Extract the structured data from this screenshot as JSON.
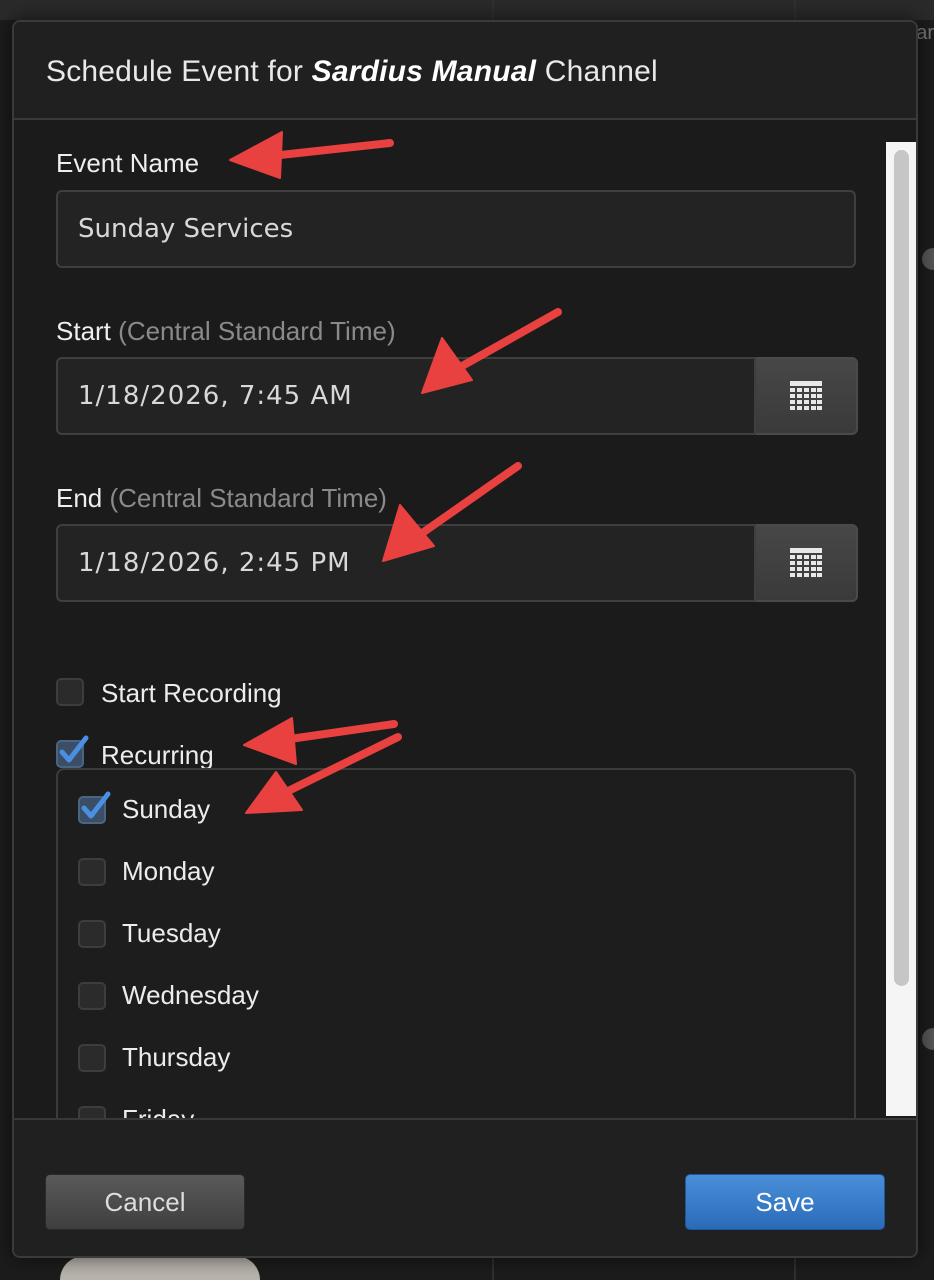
{
  "background": {
    "edge_text": "ar"
  },
  "dialog": {
    "title_prefix": "Schedule Event for",
    "channel_name": "Sardius Manual",
    "title_suffix": "Channel"
  },
  "form": {
    "event_name": {
      "label": "Event Name",
      "value": "Sunday Services"
    },
    "start": {
      "label": "Start",
      "timezone": "(Central Standard Time)",
      "value": "1/18/2026, 7:45 AM",
      "button_icon": "calendar-icon"
    },
    "end": {
      "label": "End",
      "timezone": "(Central Standard Time)",
      "value": "1/18/2026, 2:45 PM",
      "button_icon": "calendar-icon"
    },
    "start_recording": {
      "label": "Start Recording",
      "checked": false
    },
    "recurring": {
      "label": "Recurring",
      "checked": true
    },
    "days": [
      {
        "label": "Sunday",
        "checked": true
      },
      {
        "label": "Monday",
        "checked": false
      },
      {
        "label": "Tuesday",
        "checked": false
      },
      {
        "label": "Wednesday",
        "checked": false
      },
      {
        "label": "Thursday",
        "checked": false
      },
      {
        "label": "Friday",
        "checked": false
      }
    ]
  },
  "footer": {
    "cancel_label": "Cancel",
    "save_label": "Save"
  },
  "colors": {
    "accent": "#3b82d6",
    "annotation_arrow": "#e8413f",
    "checkmark": "#4a90e2"
  }
}
